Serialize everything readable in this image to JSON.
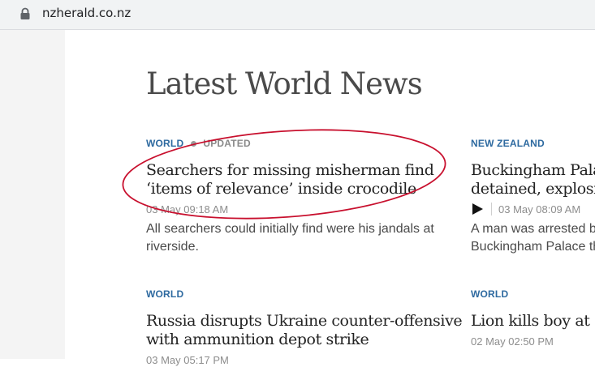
{
  "browser": {
    "url": "nzherald.co.nz"
  },
  "page": {
    "title": "Latest World News"
  },
  "articles": [
    {
      "category": "WORLD",
      "status": "UPDATED",
      "headline_line1": "Searchers for missing misherman find",
      "headline_line2": "‘items of relevance’ inside crocodile",
      "timestamp": "03 May 09:18 AM",
      "summary_line1": "All searchers could initially find were his jandals at",
      "summary_line2": "riverside."
    },
    {
      "category": "NEW ZEALAND",
      "headline_line1": "Buckingham Pala",
      "headline_line2": "detained, explosio",
      "timestamp": "03 May 08:09 AM",
      "has_video": true,
      "summary_line1": "A man was arrested by",
      "summary_line2": "Buckingham Palace th"
    },
    {
      "category": "WORLD",
      "headline_line1": "Russia disrupts Ukraine counter-offensive",
      "headline_line2": "with ammunition depot strike",
      "timestamp": "03 May 05:17 PM"
    },
    {
      "category": "WORLD",
      "headline_line1": "Lion kills boy at G",
      "timestamp": "02 May 02:50 PM"
    }
  ],
  "annotation": {
    "shape": "ellipse",
    "color": "#c8102e"
  },
  "colors": {
    "kicker": "#2e6aa0",
    "headline": "#222222",
    "meta": "#8d8d8d",
    "summary": "#4a4a4a"
  }
}
